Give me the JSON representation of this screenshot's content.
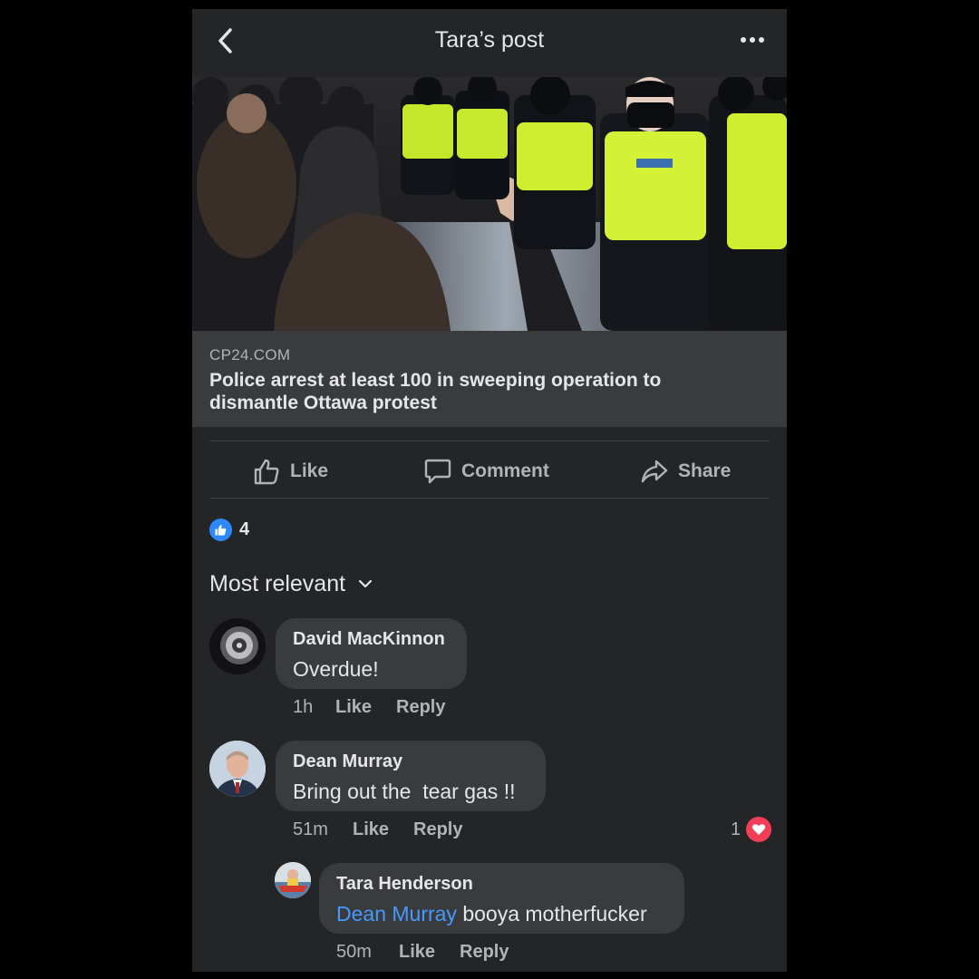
{
  "header": {
    "title": "Tara’s post",
    "back_icon": "chevron-left-icon",
    "more_icon": "more-horizontal-icon"
  },
  "post": {
    "photo_alt": "Police in high-visibility vests facing protesters",
    "link_domain": "CP24.COM",
    "link_title": "Police arrest at least 100 in sweeping operation to dismantle Ottawa protest"
  },
  "actions": {
    "like": "Like",
    "comment": "Comment",
    "share": "Share"
  },
  "reactions": {
    "count": "4",
    "icon": "thumbs-up-icon"
  },
  "sort": {
    "label": "Most relevant"
  },
  "comments": [
    {
      "author": "David MacKinnon",
      "text": "Overdue!",
      "time": "1h",
      "like": "Like",
      "reply": "Reply"
    },
    {
      "author": "Dean Murray",
      "text": "Bring out the  tear gas !!",
      "time": "51m",
      "like": "Like",
      "reply": "Reply",
      "reaction_count": "1"
    }
  ],
  "replies": [
    {
      "author": "Tara Henderson",
      "mention": "Dean Murray",
      "text": " booya motherfucker",
      "time": "50m",
      "like": "Like",
      "reply": "Reply"
    }
  ],
  "colors": {
    "background": "#242526",
    "surface": "#3a3b3c",
    "text": "#e4e6eb",
    "secondary_text": "#b0b3b8",
    "link": "#4599ff",
    "like_blue": "#2d88ff",
    "love_red": "#f33e58"
  }
}
